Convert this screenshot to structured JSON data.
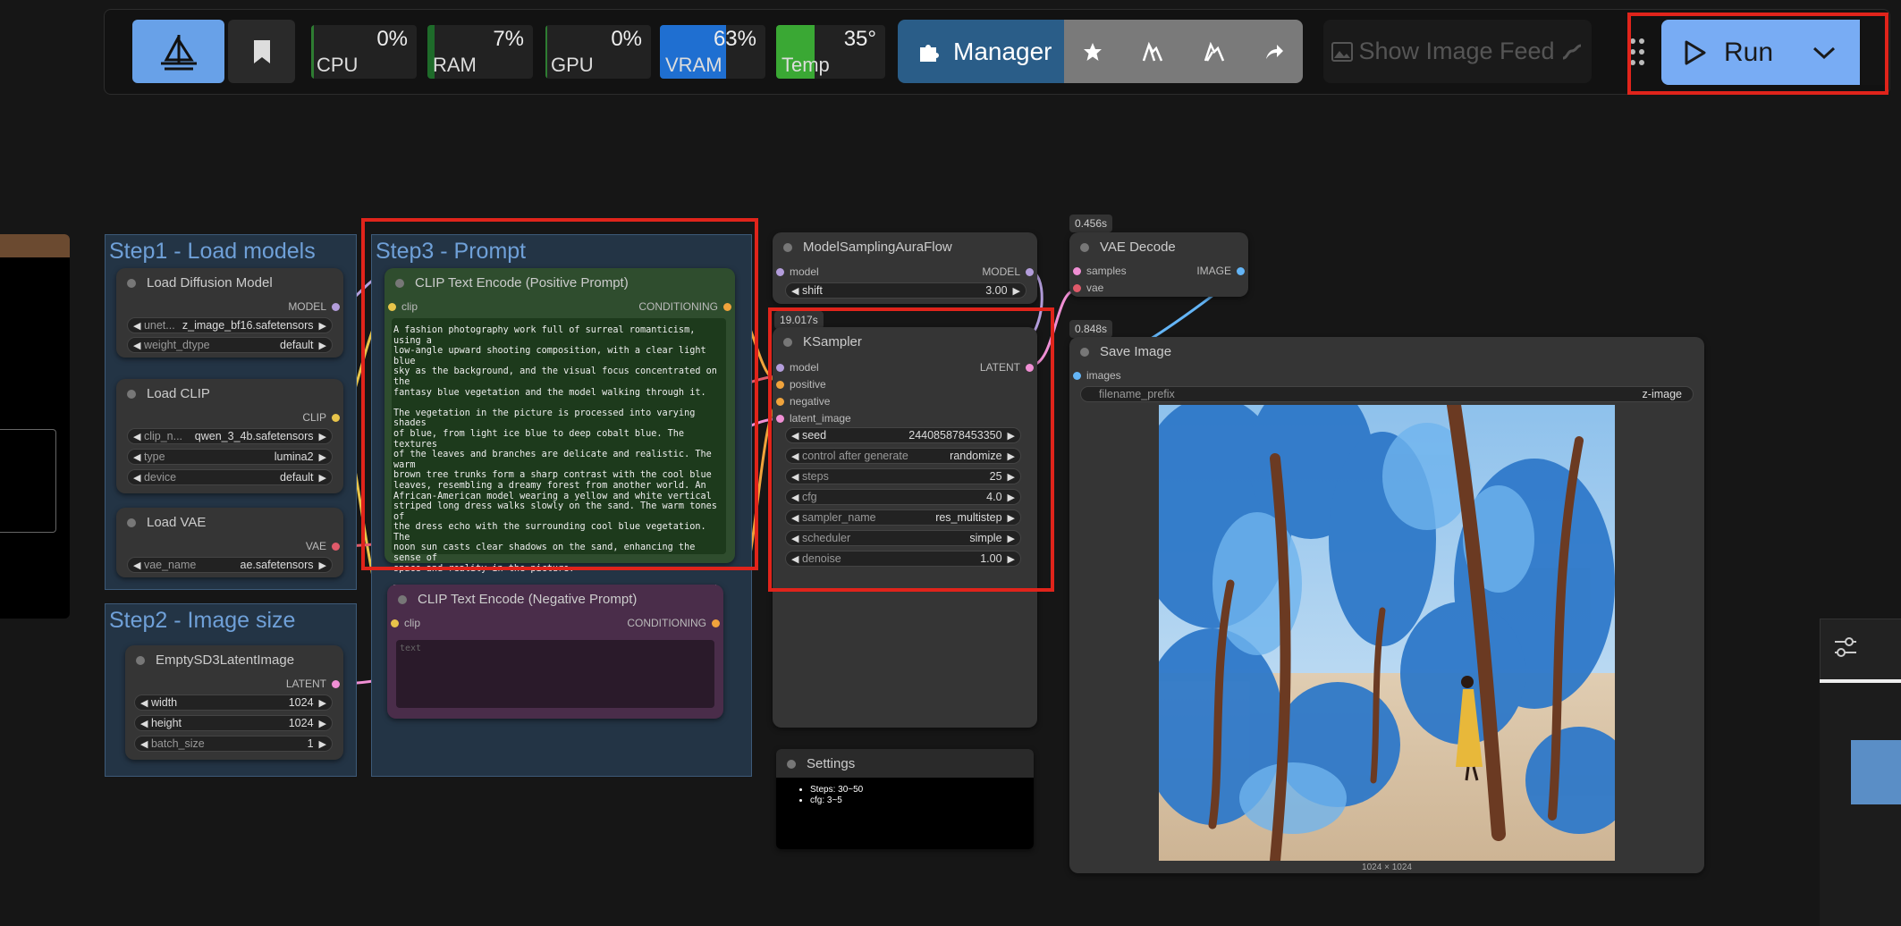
{
  "toolbar": {
    "meters": [
      {
        "label": "CPU",
        "value": "0%",
        "level": 0,
        "color": "#2e7d32"
      },
      {
        "label": "RAM",
        "value": "7%",
        "level": 0.07,
        "color": "#1e6b2a"
      },
      {
        "label": "GPU",
        "value": "0%",
        "level": 0,
        "color": "#2e7d32"
      },
      {
        "label": "VRAM",
        "value": "63%",
        "level": 0.63,
        "color": "#1f6fd1"
      },
      {
        "label": "Temp",
        "value": "35°",
        "level": 0.35,
        "color": "#3aa834"
      }
    ],
    "manager_label": "Manager",
    "feed_label": "Show Image Feed",
    "run_label": "Run"
  },
  "groups": {
    "step1": "Step1 - Load models",
    "step2": "Step2 - Image size",
    "step3": "Step3 - Prompt"
  },
  "nodes": {
    "load_diffusion": {
      "title": "Load Diffusion Model",
      "out": "MODEL",
      "w1_label": "unet...",
      "w1_value": "z_image_bf16.safetensors",
      "w2_label": "weight_dtype",
      "w2_value": "default"
    },
    "load_clip": {
      "title": "Load CLIP",
      "out": "CLIP",
      "w1_label": "clip_n...",
      "w1_value": "qwen_3_4b.safetensors",
      "w2_label": "type",
      "w2_value": "lumina2",
      "w3_label": "device",
      "w3_value": "default"
    },
    "load_vae": {
      "title": "Load VAE",
      "out": "VAE",
      "w1_label": "vae_name",
      "w1_value": "ae.safetensors"
    },
    "empty_latent": {
      "title": "EmptySD3LatentImage",
      "out": "LATENT",
      "w1_label": "width",
      "w1_value": "1024",
      "w2_label": "height",
      "w2_value": "1024",
      "w3_label": "batch_size",
      "w3_value": "1"
    },
    "clip_pos": {
      "title": "CLIP Text Encode (Positive Prompt)",
      "in": "clip",
      "out": "CONDITIONING",
      "text": "A fashion photography work full of surreal romanticism, using a\nlow-angle upward shooting composition, with a clear light blue\nsky as the background, and the visual focus concentrated on the\nfantasy blue vegetation and the model walking through it.\n\nThe vegetation in the picture is processed into varying shades\nof blue, from light ice blue to deep cobalt blue. The textures\nof the leaves and branches are delicate and realistic. The warm\nbrown tree trunks form a sharp contrast with the cool blue\nleaves, resembling a dreamy forest from another world. An\nAfrican-American model wearing a yellow and white vertical\nstriped long dress walks slowly on the sand. The warm tones of\nthe dress echo with the surrounding cool blue vegetation. The\nnoon sun casts clear shadows on the sand, enhancing the sense of\nspace and reality in the picture.\n\nThe entire scene, with its clean and transparent colors and\nfantasy settings, not only exudes the vastness of the natural\nwilderness but also presents a quiet and poetic high-fashion\nsense due to the surreal vegetation."
    },
    "clip_neg": {
      "title": "CLIP Text Encode (Negative Prompt)",
      "in": "clip",
      "out": "CONDITIONING",
      "placeholder": "text"
    },
    "model_sampling": {
      "title": "ModelSamplingAuraFlow",
      "in": "model",
      "out": "MODEL",
      "w1_label": "shift",
      "w1_value": "3.00"
    },
    "ksampler": {
      "title": "KSampler",
      "time": "19.017s",
      "in1": "model",
      "in2": "positive",
      "in3": "negative",
      "in4": "latent_image",
      "out": "LATENT",
      "widgets": [
        {
          "label": "seed",
          "value": "244085878453350"
        },
        {
          "label": "control after generate",
          "value": "randomize"
        },
        {
          "label": "steps",
          "value": "25"
        },
        {
          "label": "cfg",
          "value": "4.0"
        },
        {
          "label": "sampler_name",
          "value": "res_multistep"
        },
        {
          "label": "scheduler",
          "value": "simple"
        },
        {
          "label": "denoise",
          "value": "1.00"
        }
      ]
    },
    "vae_decode": {
      "title": "VAE Decode",
      "time": "0.456s",
      "in1": "samples",
      "in2": "vae",
      "out": "IMAGE"
    },
    "save_image": {
      "title": "Save Image",
      "time": "0.848s",
      "in": "images",
      "w1_label": "filename_prefix",
      "w1_value": "z-image",
      "caption": "1024 × 1024"
    },
    "settings": {
      "title": "Settings",
      "line1": "Steps: 30~50",
      "line2": "cfg: 3~5"
    }
  }
}
